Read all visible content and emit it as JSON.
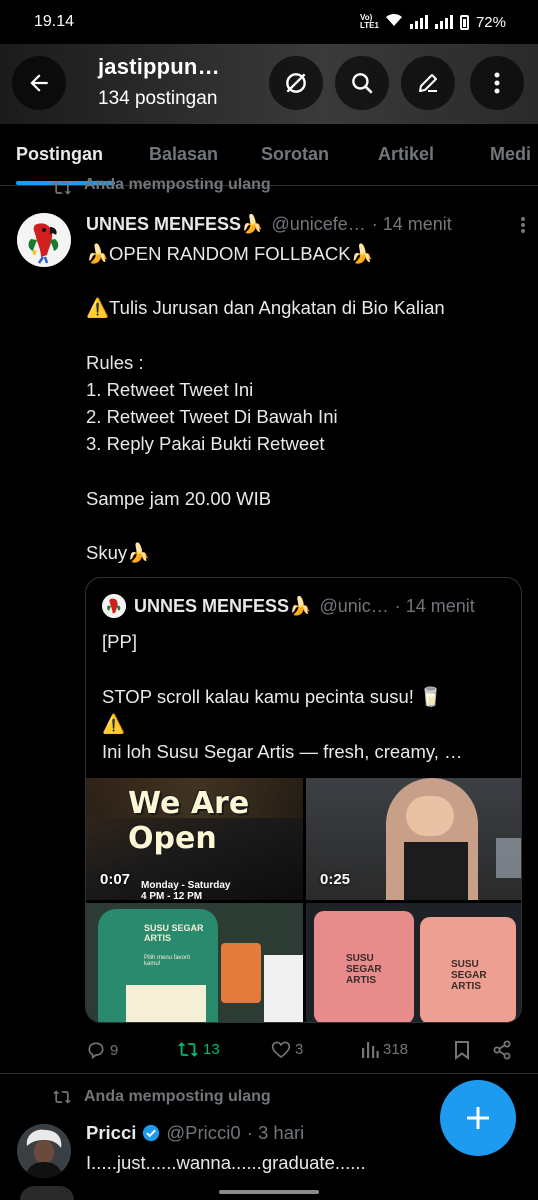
{
  "status_bar": {
    "time": "19.14",
    "network": "Vo) LTE1",
    "battery": "72%"
  },
  "header": {
    "title": "jastippun…",
    "subtitle": "134 postingan"
  },
  "tabs": [
    "Postingan",
    "Balasan",
    "Sorotan",
    "Artikel",
    "Medi"
  ],
  "posts": [
    {
      "repost_label": "Anda memposting ulang",
      "display_name": "UNNES MENFESS🍌",
      "handle": "@unicefe…",
      "time": "· 14 menit",
      "text_lines": [
        "🍌OPEN RANDOM FOLLBACK🍌",
        "",
        "⚠️Tulis Jurusan dan Angkatan di Bio Kalian",
        "",
        "Rules :",
        "1. Retweet Tweet Ini",
        "2. Retweet Tweet Di Bawah Ini",
        "3. Reply Pakai Bukti Retweet",
        "",
        "Sampe jam 20.00 WIB",
        "",
        "Skuy🍌"
      ],
      "quote": {
        "display_name": "UNNES MENFESS🍌",
        "handle": "@unic…",
        "time": "· 14 menit",
        "text_lines": [
          "[PP]",
          "",
          "STOP scroll kalau kamu pecinta susu! 🥛",
          "⚠️",
          "Ini loh Susu Segar Artis — fresh, creamy, …"
        ],
        "media": [
          {
            "type": "video",
            "duration": "0:07",
            "overlay_title": "We Are Open",
            "overlay_sub": "Monday - Saturday",
            "overlay_sub2": "4 PM - 12 PM"
          },
          {
            "type": "video",
            "duration": "0:25"
          },
          {
            "type": "image",
            "brand": "SUSU SEGAR ARTIS",
            "menu_title": "Pilih menu favorit kamu!"
          },
          {
            "type": "image",
            "brand": "SUSU SEGAR ARTIS"
          }
        ]
      },
      "stats": {
        "replies": "9",
        "reposts": "13",
        "likes": "3",
        "views": "318"
      }
    },
    {
      "repost_label": "Anda memposting ulang",
      "display_name": "Pricci",
      "handle": "@Pricci0",
      "time": "· 3 hari",
      "text": "I.....just......wanna......graduate......"
    }
  ],
  "colors": {
    "accent": "#1d9bf0",
    "repost_active": "#00ba7c",
    "muted": "#71767b",
    "text": "#e7e9ea",
    "background": "#000000"
  },
  "icons": {
    "back": "arrow-left-icon",
    "mute": "slash-circle-icon",
    "search": "search-icon",
    "edit": "pencil-icon",
    "more": "more-vertical-icon",
    "repost": "repost-icon",
    "reply": "speech-bubble-icon",
    "like": "heart-icon",
    "views": "bar-chart-icon",
    "bookmark": "bookmark-icon",
    "share": "share-icon",
    "compose": "plus-icon",
    "verified": "verified-badge-icon"
  }
}
